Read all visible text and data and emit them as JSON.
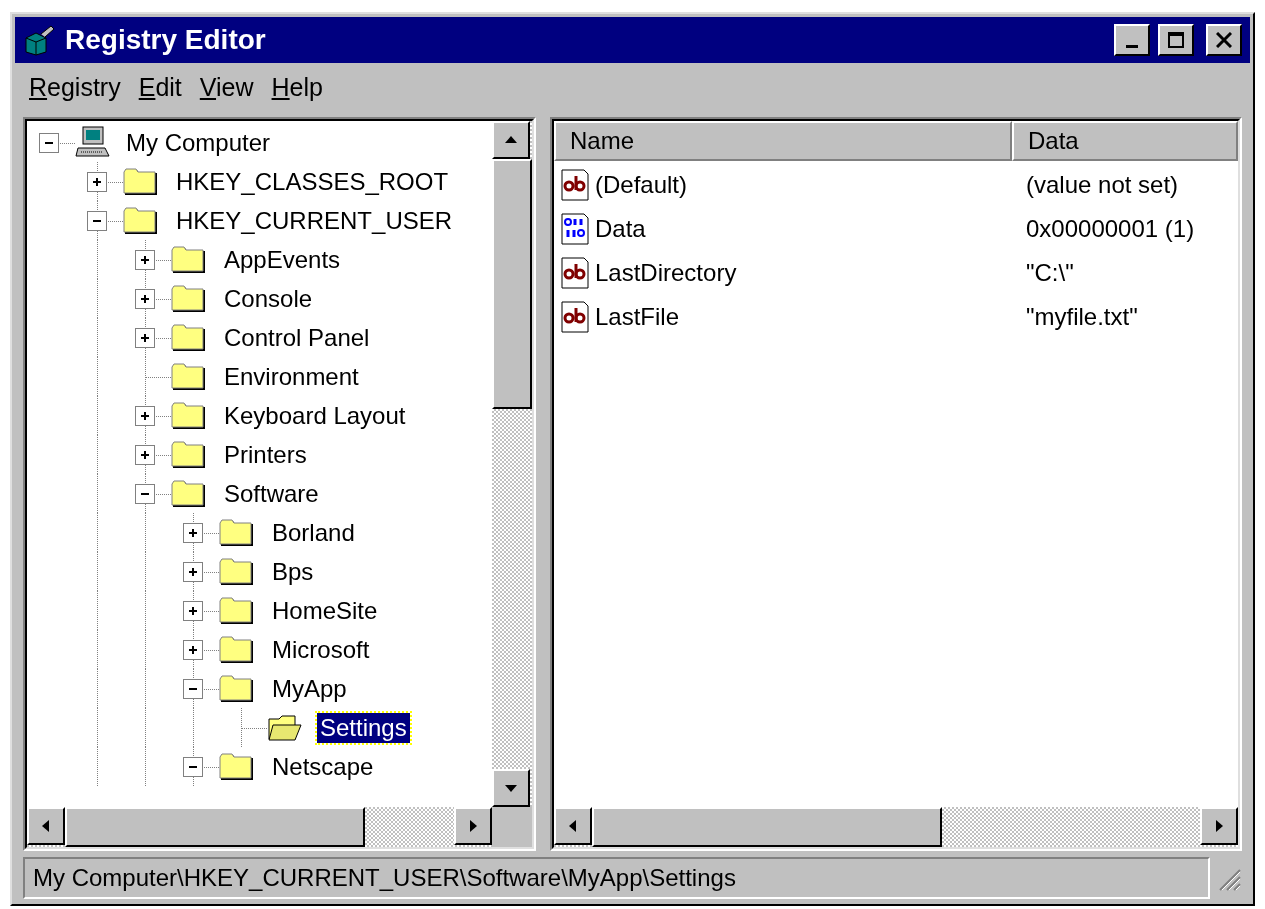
{
  "window": {
    "title": "Registry Editor"
  },
  "menu": [
    {
      "label": "Registry"
    },
    {
      "label": "Edit"
    },
    {
      "label": "View"
    },
    {
      "label": "Help"
    }
  ],
  "tree": [
    {
      "label": "My Computer",
      "kind": "expanded",
      "selected": false,
      "children": [
        {
          "label": "HKEY_CLASSES_ROOT",
          "kind": "collapsed",
          "selected": false
        },
        {
          "label": "HKEY_CURRENT_USER",
          "kind": "expanded",
          "selected": false,
          "children": [
            {
              "label": "AppEvents",
              "kind": "collapsed",
              "selected": false
            },
            {
              "label": "Console",
              "kind": "collapsed",
              "selected": false
            },
            {
              "label": "Control Panel",
              "kind": "collapsed",
              "selected": false
            },
            {
              "label": "Environment",
              "kind": "leaf",
              "selected": false
            },
            {
              "label": "Keyboard Layout",
              "kind": "collapsed",
              "selected": false
            },
            {
              "label": "Printers",
              "kind": "collapsed",
              "selected": false
            },
            {
              "label": "Software",
              "kind": "expanded",
              "selected": false,
              "children": [
                {
                  "label": "Borland",
                  "kind": "collapsed",
                  "selected": false
                },
                {
                  "label": "Bps",
                  "kind": "collapsed",
                  "selected": false
                },
                {
                  "label": "HomeSite",
                  "kind": "collapsed",
                  "selected": false
                },
                {
                  "label": "Microsoft",
                  "kind": "collapsed",
                  "selected": false
                },
                {
                  "label": "MyApp",
                  "kind": "expanded",
                  "selected": false,
                  "children": [
                    {
                      "label": "Settings",
                      "kind": "leaf",
                      "selected": true
                    }
                  ]
                },
                {
                  "label": "Netscape",
                  "kind": "expanded",
                  "selected": false
                }
              ]
            }
          ]
        }
      ]
    }
  ],
  "values_table": {
    "columns": [
      "Name",
      "Data"
    ],
    "rows": [
      {
        "kind": "string",
        "name": "(Default)",
        "data": "(value not set)",
        "selected": false
      },
      {
        "kind": "dword",
        "name": "Data",
        "data": "0x00000001 (1)",
        "selected": false
      },
      {
        "kind": "string",
        "name": "LastDirectory",
        "data": "\"C:\\\"",
        "selected": false
      },
      {
        "kind": "string",
        "name": "LastFile",
        "data": "\"myfile.txt\"",
        "selected": false
      }
    ]
  },
  "status_bar": {
    "text": "My Computer\\HKEY_CURRENT_USER\\Software\\MyApp\\Settings"
  }
}
